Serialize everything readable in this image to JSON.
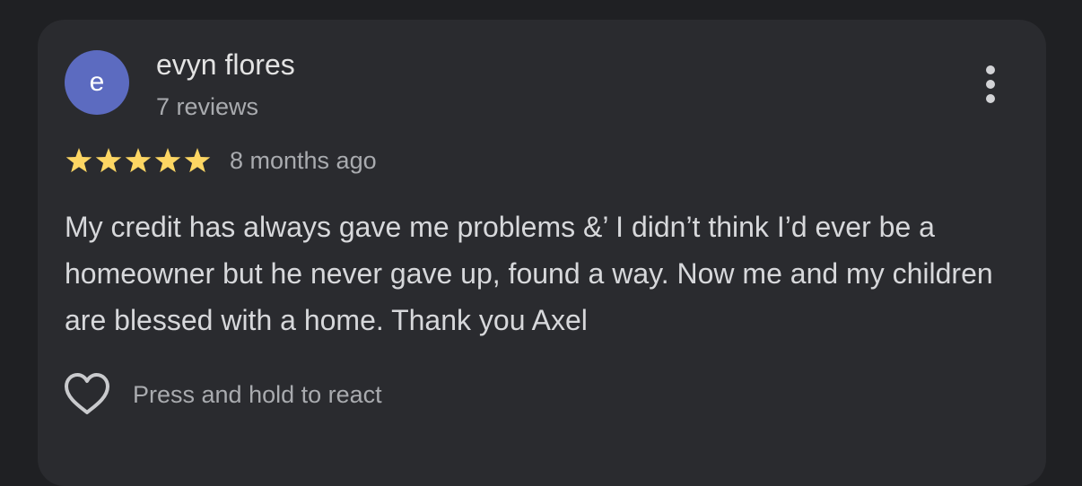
{
  "review": {
    "avatar_initial": "e",
    "avatar_color": "#5c6bc0",
    "author_name": "evyn flores",
    "author_review_count": "7 reviews",
    "rating": 5,
    "rating_max": 5,
    "star_color": "#fdd663",
    "star_icon": "star-icon",
    "timestamp": "8 months ago",
    "text": "My credit has always gave me problems &’ I didn’t think I’d ever be a homeowner but he never gave up, found a way. Now me and my children are blessed with a home. Thank you Axel",
    "more_icon": "more-vertical-icon",
    "react_icon": "heart-outline-icon",
    "react_label": "Press and hold to react"
  },
  "theme": {
    "background": "#1f2023",
    "card_background": "#2a2b2f"
  }
}
